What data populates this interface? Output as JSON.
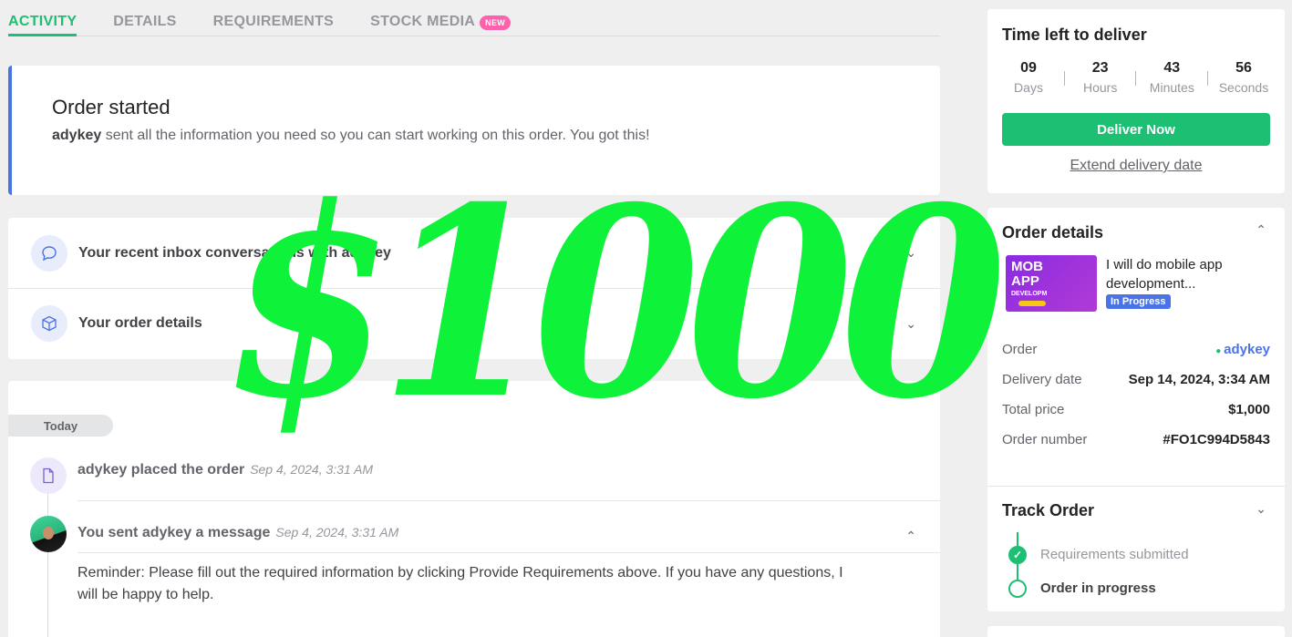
{
  "tabs": {
    "activity": "ACTIVITY",
    "details": "DETAILS",
    "requirements": "REQUIREMENTS",
    "stock_media": "STOCK MEDIA",
    "new_badge": "NEW"
  },
  "order_started": {
    "title": "Order started",
    "buyer": "adykey",
    "message": " sent all the information you need so you can start working on this order. You got this!"
  },
  "accordion": {
    "inbox_label": "Your recent inbox conversations with adykey",
    "details_label": "Your order details"
  },
  "timeline": {
    "day_label": "Today",
    "placed_text": "adykey placed the order",
    "placed_time": "Sep 4, 2024, 3:31 AM",
    "sent_text": "You sent adykey a message",
    "sent_time": "Sep 4, 2024, 3:31 AM",
    "message": "Reminder: Please fill out the required information by clicking Provide Requirements above. If you have any questions, I will be happy to help."
  },
  "deliver": {
    "title": "Time left to deliver",
    "days": "09",
    "days_label": "Days",
    "hours": "23",
    "hours_label": "Hours",
    "minutes": "43",
    "minutes_label": "Minutes",
    "seconds": "56",
    "seconds_label": "Seconds",
    "button": "Deliver Now",
    "extend": "Extend delivery date"
  },
  "order_details": {
    "title": "Order details",
    "gig_title": "I will do mobile app development...",
    "thumb_line1": "MOB",
    "thumb_line2": "APP",
    "thumb_line3": "DEVELOPM",
    "status": "In Progress",
    "rows": [
      {
        "key": "Order",
        "value": "adykey"
      },
      {
        "key": "Delivery date",
        "value": "Sep 14, 2024, 3:34 AM"
      },
      {
        "key": "Total price",
        "value": "$1,000"
      },
      {
        "key": "Order number",
        "value": "#FO1C994D5843"
      }
    ]
  },
  "track": {
    "title": "Track Order",
    "step1": "Requirements submitted",
    "step2": "Order in progress"
  },
  "overlay": {
    "text": "$1000",
    "color": "#0ef23a"
  }
}
